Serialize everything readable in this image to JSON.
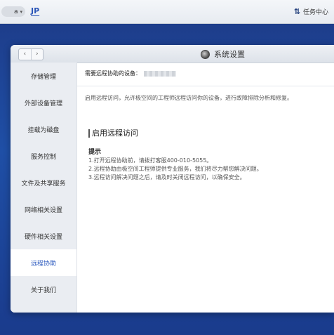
{
  "topbar": {
    "user_label": "a",
    "language": "JP",
    "tasks_label": "任务中心"
  },
  "window": {
    "title": "系统设置",
    "nav_back": "‹",
    "nav_forward": "›"
  },
  "sidebar": {
    "items": [
      {
        "label": "存储管理"
      },
      {
        "label": "外部设备管理"
      },
      {
        "label": "挂载为磁盘"
      },
      {
        "label": "服务控制"
      },
      {
        "label": "文件及共享服务"
      },
      {
        "label": "网络相关设置"
      },
      {
        "label": "硬件相关设置"
      },
      {
        "label": "远程协助"
      },
      {
        "label": "关于我们"
      }
    ],
    "active_index": 7
  },
  "content": {
    "device_label": "需要远程协助的设备：",
    "description": "启用远程访问，允许极空间的工程师远程访问你的设备，进行故障排除分析和修复。",
    "section_title": "启用远程访问",
    "tips_title": "提示",
    "tips": [
      "1.打开远程协助前，请拨打客服400-010-5055。",
      "2.远程协助由极空间工程师提供专业服务，我们将尽力帮您解决问题。",
      "3.远程访问解决问题之后，请及时关闭远程访问，以确保安全。"
    ]
  },
  "colors": {
    "accent": "#2d5bbf",
    "desktop": "#1f4fa6"
  }
}
